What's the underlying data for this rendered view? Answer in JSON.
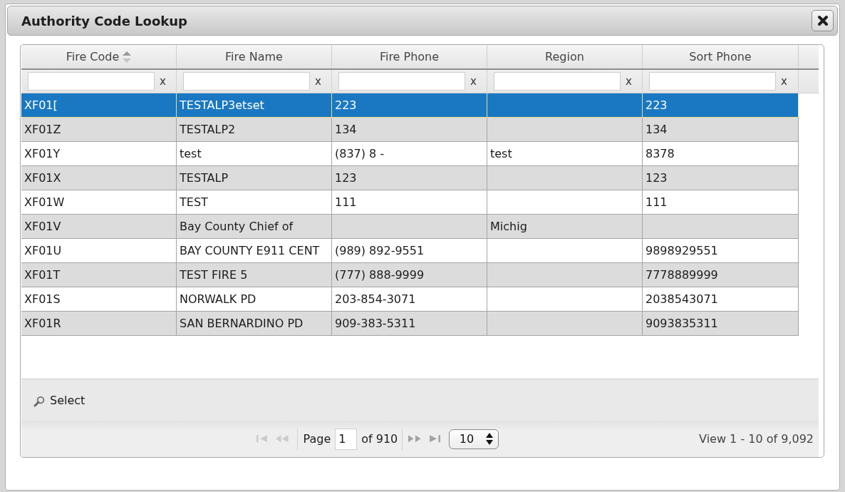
{
  "dialog": {
    "title": "Authority Code Lookup"
  },
  "grid": {
    "columns": [
      {
        "label": "Fire Code",
        "sortable": true
      },
      {
        "label": "Fire Name",
        "sortable": false
      },
      {
        "label": "Fire Phone",
        "sortable": false
      },
      {
        "label": "Region",
        "sortable": false
      },
      {
        "label": "Sort Phone",
        "sortable": false
      }
    ],
    "filters": [
      {
        "clear": "x"
      },
      {
        "clear": "x"
      },
      {
        "clear": "x"
      },
      {
        "clear": "x"
      },
      {
        "clear": "x"
      }
    ],
    "rows": [
      {
        "fire_code": "XF01[",
        "fire_name": "TESTALP3etset",
        "fire_phone": "223",
        "sort_phone": "223",
        "selected": true
      },
      {
        "fire_code": "XF01Z",
        "fire_name": "TESTALP2",
        "fire_phone": "134",
        "sort_phone": "134",
        "selected": false
      },
      {
        "fire_code": "XF01Y",
        "fire_name": "test",
        "fire_phone": "(837) 8 -",
        "region": "test",
        "sort_phone": "8378",
        "selected": false
      },
      {
        "fire_code": "XF01X",
        "fire_name": "TESTALP",
        "fire_phone": "123",
        "sort_phone": "123",
        "selected": false
      },
      {
        "fire_code": "XF01W",
        "fire_name": "TEST",
        "fire_phone": "111",
        "sort_phone": "111",
        "selected": false
      },
      {
        "fire_code": "XF01V",
        "fire_name": "Bay County Chief of",
        "region": "Michig",
        "selected": false
      },
      {
        "fire_code": "XF01U",
        "fire_name": "BAY COUNTY E911 CENT",
        "fire_phone": "(989) 892-9551",
        "sort_phone": "9898929551",
        "selected": false
      },
      {
        "fire_code": "XF01T",
        "fire_name": "TEST FIRE 5",
        "fire_phone": "(777) 888-9999",
        "sort_phone": "7778889999",
        "selected": false
      },
      {
        "fire_code": "XF01S",
        "fire_name": "NORWALK PD",
        "fire_phone": "203-854-3071",
        "sort_phone": "2038543071",
        "selected": false
      },
      {
        "fire_code": "XF01R",
        "fire_name": "SAN BERNARDINO PD",
        "fire_phone": "909-383-5311",
        "sort_phone": "9093835311",
        "selected": false
      }
    ]
  },
  "toolbar": {
    "buttons": [
      {
        "label": "Select"
      }
    ]
  },
  "pager": {
    "back_buttons": [
      {
        "kind": "first",
        "disabled": true
      },
      {
        "kind": "previous",
        "disabled": true
      }
    ],
    "page_label": "Page",
    "page": "1",
    "page_total": "of 910",
    "forward_buttons": [
      {
        "kind": "next",
        "disabled": false
      },
      {
        "kind": "last",
        "disabled": false
      }
    ],
    "page_size": "10",
    "summary": "View 1 - 10 of 9,092"
  }
}
